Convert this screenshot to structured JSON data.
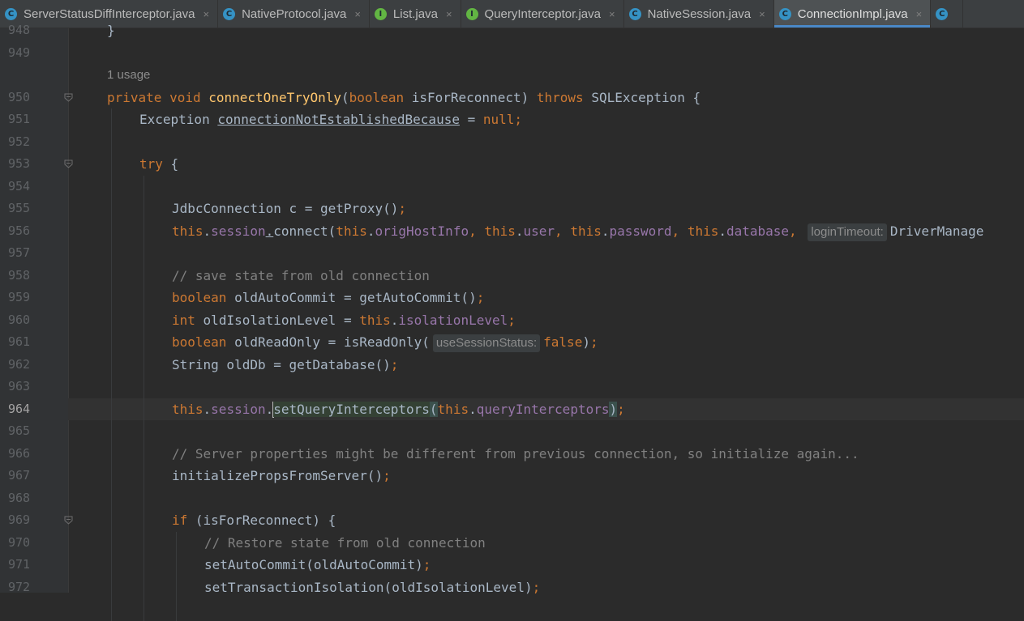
{
  "tabs": [
    {
      "label": "ServerStatusDiffInterceptor.java",
      "icon": "class-icon",
      "glyph": "C",
      "kind": "class",
      "active": false
    },
    {
      "label": "NativeProtocol.java",
      "icon": "class-icon",
      "glyph": "C",
      "kind": "class",
      "active": false
    },
    {
      "label": "List.java",
      "icon": "interface-icon",
      "glyph": "I",
      "kind": "iface",
      "active": false
    },
    {
      "label": "QueryInterceptor.java",
      "icon": "interface-icon",
      "glyph": "I",
      "kind": "iface",
      "active": false
    },
    {
      "label": "NativeSession.java",
      "icon": "class-icon",
      "glyph": "C",
      "kind": "class",
      "active": false
    },
    {
      "label": "ConnectionImpl.java",
      "icon": "class-icon",
      "glyph": "C",
      "kind": "class",
      "active": true
    },
    {
      "label": "",
      "icon": "class-icon",
      "glyph": "C",
      "kind": "class",
      "active": false
    }
  ],
  "close_glyph": "×",
  "colors": {
    "background": "#2b2b2b",
    "keyword": "#cc7832",
    "method": "#ffc66d",
    "field": "#9876aa",
    "comment": "#808080",
    "text": "#a9b7c6",
    "accent": "#4a88c7"
  },
  "editor": {
    "current_line": "964",
    "usage_hint": "1 usage",
    "lines": [
      {
        "num": "948",
        "text": "}",
        "fold": false
      },
      {
        "num": "949",
        "text": "",
        "fold": false
      },
      {
        "num": "950",
        "text": "private void connectOneTryOnly(boolean isForReconnect) throws SQLException {",
        "fold": true
      },
      {
        "num": "951",
        "text": "Exception connectionNotEstablishedBecause = null;",
        "fold": false
      },
      {
        "num": "952",
        "text": "",
        "fold": false
      },
      {
        "num": "953",
        "text": "try {",
        "fold": true
      },
      {
        "num": "954",
        "text": "",
        "fold": false
      },
      {
        "num": "955",
        "text": "JdbcConnection c = getProxy();",
        "fold": false
      },
      {
        "num": "956",
        "text": "this.session.connect(this.origHostInfo, this.user, this.password, this.database, loginTimeout: DriverManage",
        "fold": false
      },
      {
        "num": "957",
        "text": "",
        "fold": false
      },
      {
        "num": "958",
        "text": "// save state from old connection",
        "fold": false
      },
      {
        "num": "959",
        "text": "boolean oldAutoCommit = getAutoCommit();",
        "fold": false
      },
      {
        "num": "960",
        "text": "int oldIsolationLevel = this.isolationLevel;",
        "fold": false
      },
      {
        "num": "961",
        "text": "boolean oldReadOnly = isReadOnly( useSessionStatus: false);",
        "fold": false
      },
      {
        "num": "962",
        "text": "String oldDb = getDatabase();",
        "fold": false
      },
      {
        "num": "963",
        "text": "",
        "fold": false
      },
      {
        "num": "964",
        "text": "this.session.setQueryInterceptors(this.queryInterceptors);",
        "fold": false
      },
      {
        "num": "965",
        "text": "",
        "fold": false
      },
      {
        "num": "966",
        "text": "// Server properties might be different from previous connection, so initialize again...",
        "fold": false
      },
      {
        "num": "967",
        "text": "initializePropsFromServer();",
        "fold": false
      },
      {
        "num": "968",
        "text": "",
        "fold": false
      },
      {
        "num": "969",
        "text": "if (isForReconnect) {",
        "fold": true
      },
      {
        "num": "970",
        "text": "// Restore state from old connection",
        "fold": false
      },
      {
        "num": "971",
        "text": "setAutoCommit(oldAutoCommit);",
        "fold": false
      },
      {
        "num": "972",
        "text": "setTransactionIsolation(oldIsolationLevel);",
        "fold": false
      }
    ]
  },
  "code": {
    "l948": {
      "brace": "}"
    },
    "l950": {
      "kw_private": "private",
      "kw_void": "void",
      "method": "connectOneTryOnly",
      "paren_open": "(",
      "kw_boolean": "boolean",
      "param": "isForReconnect",
      "paren_close": ")",
      "kw_throws": "throws",
      "exc": "SQLException",
      "brace": "{"
    },
    "l951": {
      "type": "Exception",
      "var": "connectionNotEstablishedBecause",
      "eq": "=",
      "kw_null": "null",
      "semi": ";"
    },
    "l953": {
      "kw_try": "try",
      "brace": "{"
    },
    "l955": {
      "text": "JdbcConnection c = getProxy()",
      "semi": ";"
    },
    "l956": {
      "kw_this1": "this",
      "dot1": ".",
      "f_session": "session",
      "dot2": ".",
      "call": "connect(",
      "kw_this2": "this",
      "dot3": ".",
      "f_orig": "origHostInfo",
      "comma1": ", ",
      "kw_this3": "this",
      "dot4": ".",
      "f_user": "user",
      "comma2": ", ",
      "kw_this4": "this",
      "dot5": ".",
      "f_password": "password",
      "comma3": ", ",
      "kw_this5": "this",
      "dot6": ".",
      "f_database": "database",
      "comma4": ", ",
      "hint": "loginTimeout:",
      "tail": "DriverManage"
    },
    "l958": {
      "comment": "// save state from old connection"
    },
    "l959": {
      "kw": "boolean",
      "text": "oldAutoCommit = getAutoCommit()",
      "semi": ";"
    },
    "l960": {
      "kw": "int",
      "text1": "oldIsolationLevel = ",
      "kw_this": "this",
      "dot": ".",
      "field": "isolationLevel",
      "semi": ";"
    },
    "l961": {
      "kw": "boolean",
      "text": "oldReadOnly = isReadOnly(",
      "hint": "useSessionStatus:",
      "kw_false": "false",
      "close": ")",
      "semi": ";"
    },
    "l962": {
      "text": "String oldDb = getDatabase()",
      "semi": ";"
    },
    "l964": {
      "kw_this1": "this",
      "dot1": ".",
      "f_session": "session",
      "dot2": ".",
      "method": "setQueryInterceptors",
      "paren_open": "(",
      "kw_this2": "this",
      "dot3": ".",
      "f_qi": "queryInterceptors",
      "paren_close": ")",
      "semi": ";"
    },
    "l966": {
      "comment": "// Server properties might be different from previous connection, so initialize again..."
    },
    "l967": {
      "text": "initializePropsFromServer()",
      "semi": ";"
    },
    "l969": {
      "kw_if": "if",
      "text": " (isForReconnect) {"
    },
    "l970": {
      "comment": "// Restore state from old connection"
    },
    "l971": {
      "text": "setAutoCommit(oldAutoCommit)",
      "semi": ";"
    },
    "l972": {
      "text": "setTransactionIsolation(oldIsolationLevel)",
      "semi": ";"
    }
  }
}
